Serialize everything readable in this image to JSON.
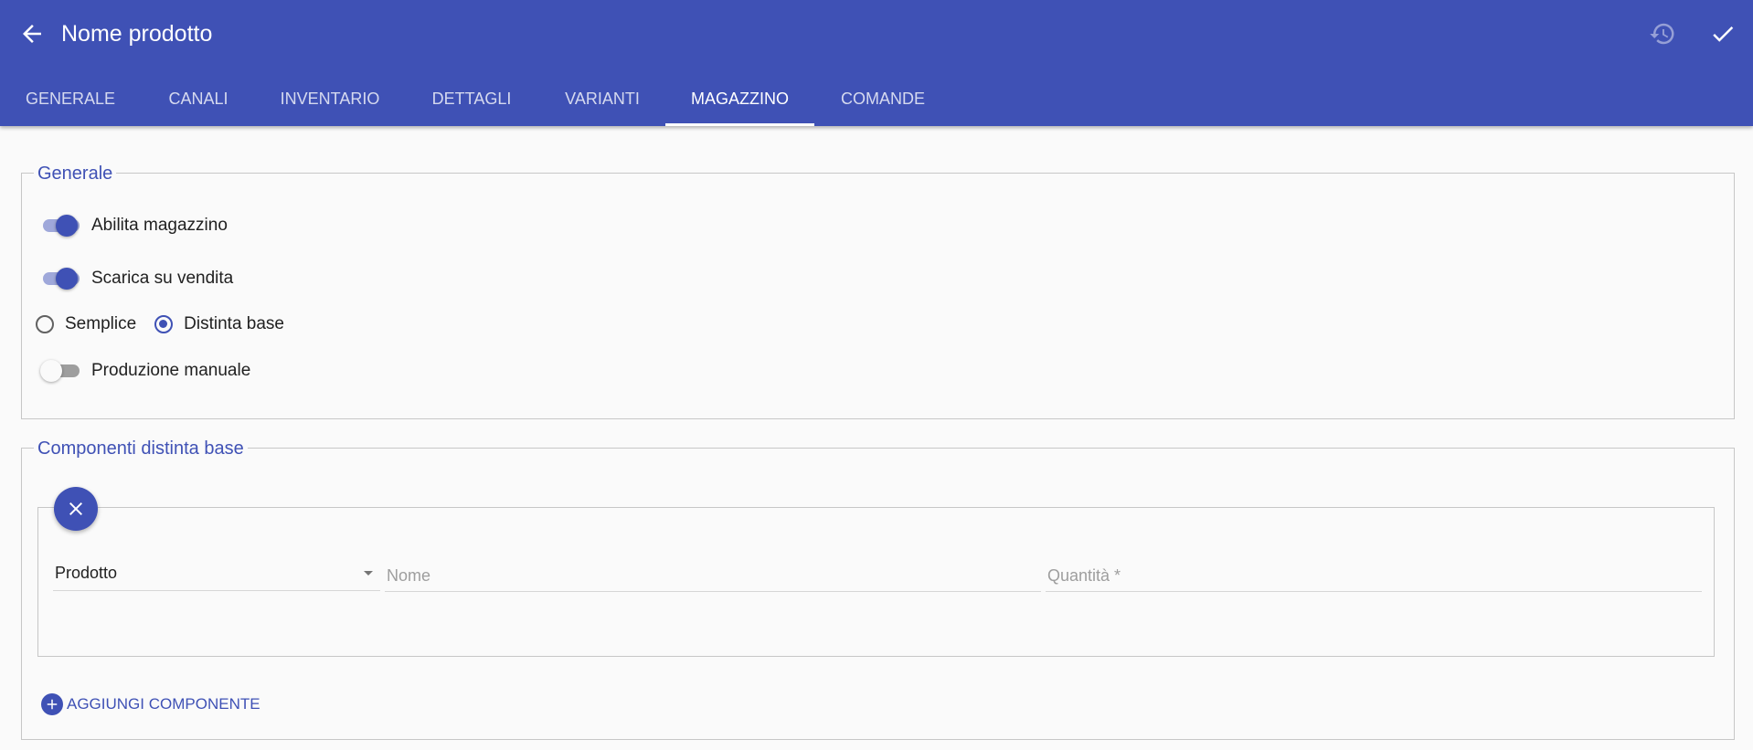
{
  "header": {
    "title": "Nome prodotto",
    "back_icon": "arrow-back-icon",
    "restore_icon": "restore-icon",
    "save_icon": "check-icon",
    "accent": "#3f51b5"
  },
  "tabs": [
    {
      "label": "GENERALE"
    },
    {
      "label": "CANALI"
    },
    {
      "label": "INVENTARIO"
    },
    {
      "label": "DETTAGLI"
    },
    {
      "label": "VARIANTI"
    },
    {
      "label": "MAGAZZINO",
      "active": true
    },
    {
      "label": "COMANDE"
    }
  ],
  "generale": {
    "legend": "Generale",
    "abilita_magazzino": {
      "label": "Abilita magazzino",
      "on": true
    },
    "scarica_su_vendita": {
      "label": "Scarica su vendita",
      "on": true
    },
    "tipo": {
      "options": [
        "Semplice",
        "Distinta base"
      ],
      "selected": "Distinta base"
    },
    "produzione_manuale": {
      "label": "Produzione manuale",
      "on": false
    }
  },
  "componenti": {
    "legend": "Componenti distinta base",
    "rows": [
      {
        "prodotto": "Prodotto",
        "nome_placeholder": "Nome",
        "quantita_placeholder": "Quantità *"
      }
    ],
    "add_label": "AGGIUNGI COMPONENTE"
  }
}
